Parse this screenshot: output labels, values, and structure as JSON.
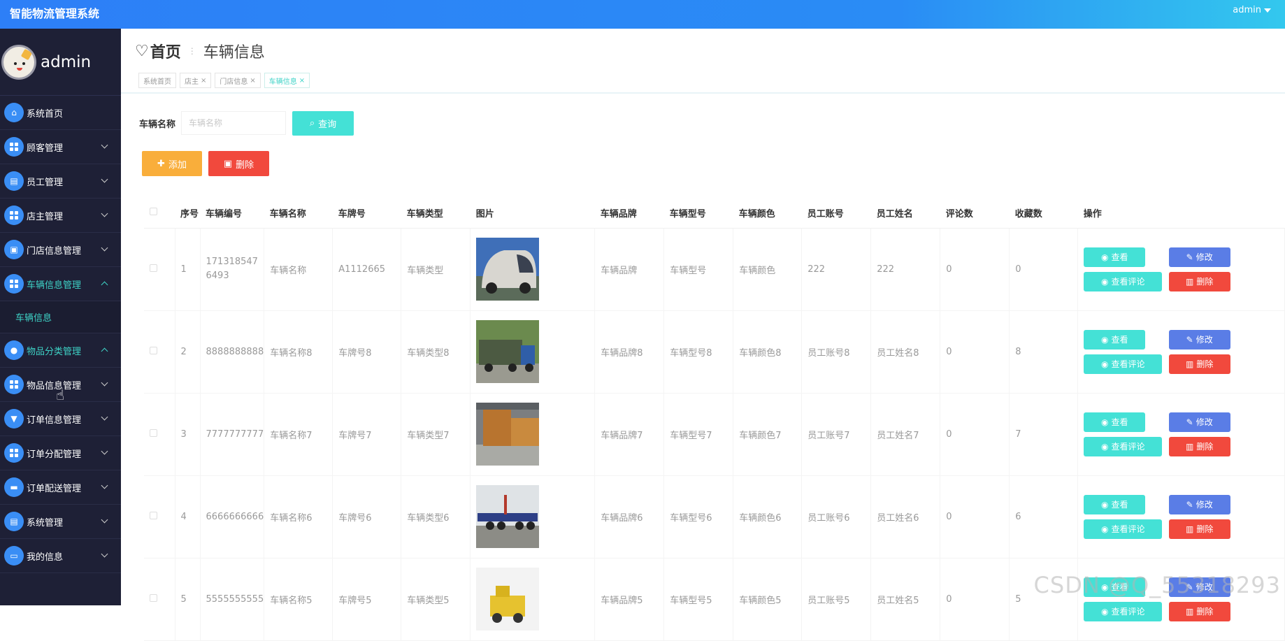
{
  "app": {
    "title": "智能物流管理系统",
    "user": "admin"
  },
  "sidebar": {
    "username": "admin",
    "items": [
      {
        "label": "系统首页"
      },
      {
        "label": "顾客管理"
      },
      {
        "label": "员工管理"
      },
      {
        "label": "店主管理"
      },
      {
        "label": "门店信息管理"
      },
      {
        "label": "车辆信息管理"
      },
      {
        "label": "物品分类管理"
      },
      {
        "label": "物品信息管理"
      },
      {
        "label": "订单信息管理"
      },
      {
        "label": "订单分配管理"
      },
      {
        "label": "订单配送管理"
      },
      {
        "label": "系统管理"
      },
      {
        "label": "我的信息"
      }
    ],
    "submenu": {
      "label": "车辆信息"
    }
  },
  "breadcrumb": {
    "home": "首页",
    "current": "车辆信息"
  },
  "tabs": [
    {
      "label": "系统首页"
    },
    {
      "label": "店主"
    },
    {
      "label": "门店信息"
    },
    {
      "label": "车辆信息"
    }
  ],
  "search": {
    "label": "车辆名称",
    "placeholder": "车辆名称",
    "button": "查询"
  },
  "actions": {
    "add": "添加",
    "delete": "删除"
  },
  "table": {
    "headers": [
      "序号",
      "车辆编号",
      "车辆名称",
      "车牌号",
      "车辆类型",
      "图片",
      "车辆品牌",
      "车辆型号",
      "车辆颜色",
      "员工账号",
      "员工姓名",
      "评论数",
      "收藏数",
      "操作"
    ],
    "rows": [
      {
        "idx": "1",
        "code": "1713185476493",
        "name": "车辆名称",
        "plate": "A1112665",
        "type": "车辆类型",
        "brand": "车辆品牌",
        "model": "车辆型号",
        "color": "车辆颜色",
        "account": "222",
        "staff": "222",
        "comments": "0",
        "favorites": "0"
      },
      {
        "idx": "2",
        "code": "8888888888",
        "name": "车辆名称8",
        "plate": "车牌号8",
        "type": "车辆类型8",
        "brand": "车辆品牌8",
        "model": "车辆型号8",
        "color": "车辆颜色8",
        "account": "员工账号8",
        "staff": "员工姓名8",
        "comments": "0",
        "favorites": "8"
      },
      {
        "idx": "3",
        "code": "7777777777",
        "name": "车辆名称7",
        "plate": "车牌号7",
        "type": "车辆类型7",
        "brand": "车辆品牌7",
        "model": "车辆型号7",
        "color": "车辆颜色7",
        "account": "员工账号7",
        "staff": "员工姓名7",
        "comments": "0",
        "favorites": "7"
      },
      {
        "idx": "4",
        "code": "6666666666",
        "name": "车辆名称6",
        "plate": "车牌号6",
        "type": "车辆类型6",
        "brand": "车辆品牌6",
        "model": "车辆型号6",
        "color": "车辆颜色6",
        "account": "员工账号6",
        "staff": "员工姓名6",
        "comments": "0",
        "favorites": "6"
      },
      {
        "idx": "5",
        "code": "5555555555",
        "name": "车辆名称5",
        "plate": "车牌号5",
        "type": "车辆类型5",
        "brand": "车辆品牌5",
        "model": "车辆型号5",
        "color": "车辆颜色5",
        "account": "员工账号5",
        "staff": "员工姓名5",
        "comments": "0",
        "favorites": "5"
      }
    ],
    "row_actions": {
      "view": "查看",
      "edit": "修改",
      "comment": "查看评论",
      "delete": "删除"
    }
  },
  "watermark": "CSDN @Q_55318293",
  "colors": {
    "topbar": "#2d7ff7",
    "sidebar": "#1e2036",
    "accent": "#44e1d6",
    "danger": "#f1493d",
    "warning": "#f9ae3b",
    "edit": "#5a7de6"
  }
}
